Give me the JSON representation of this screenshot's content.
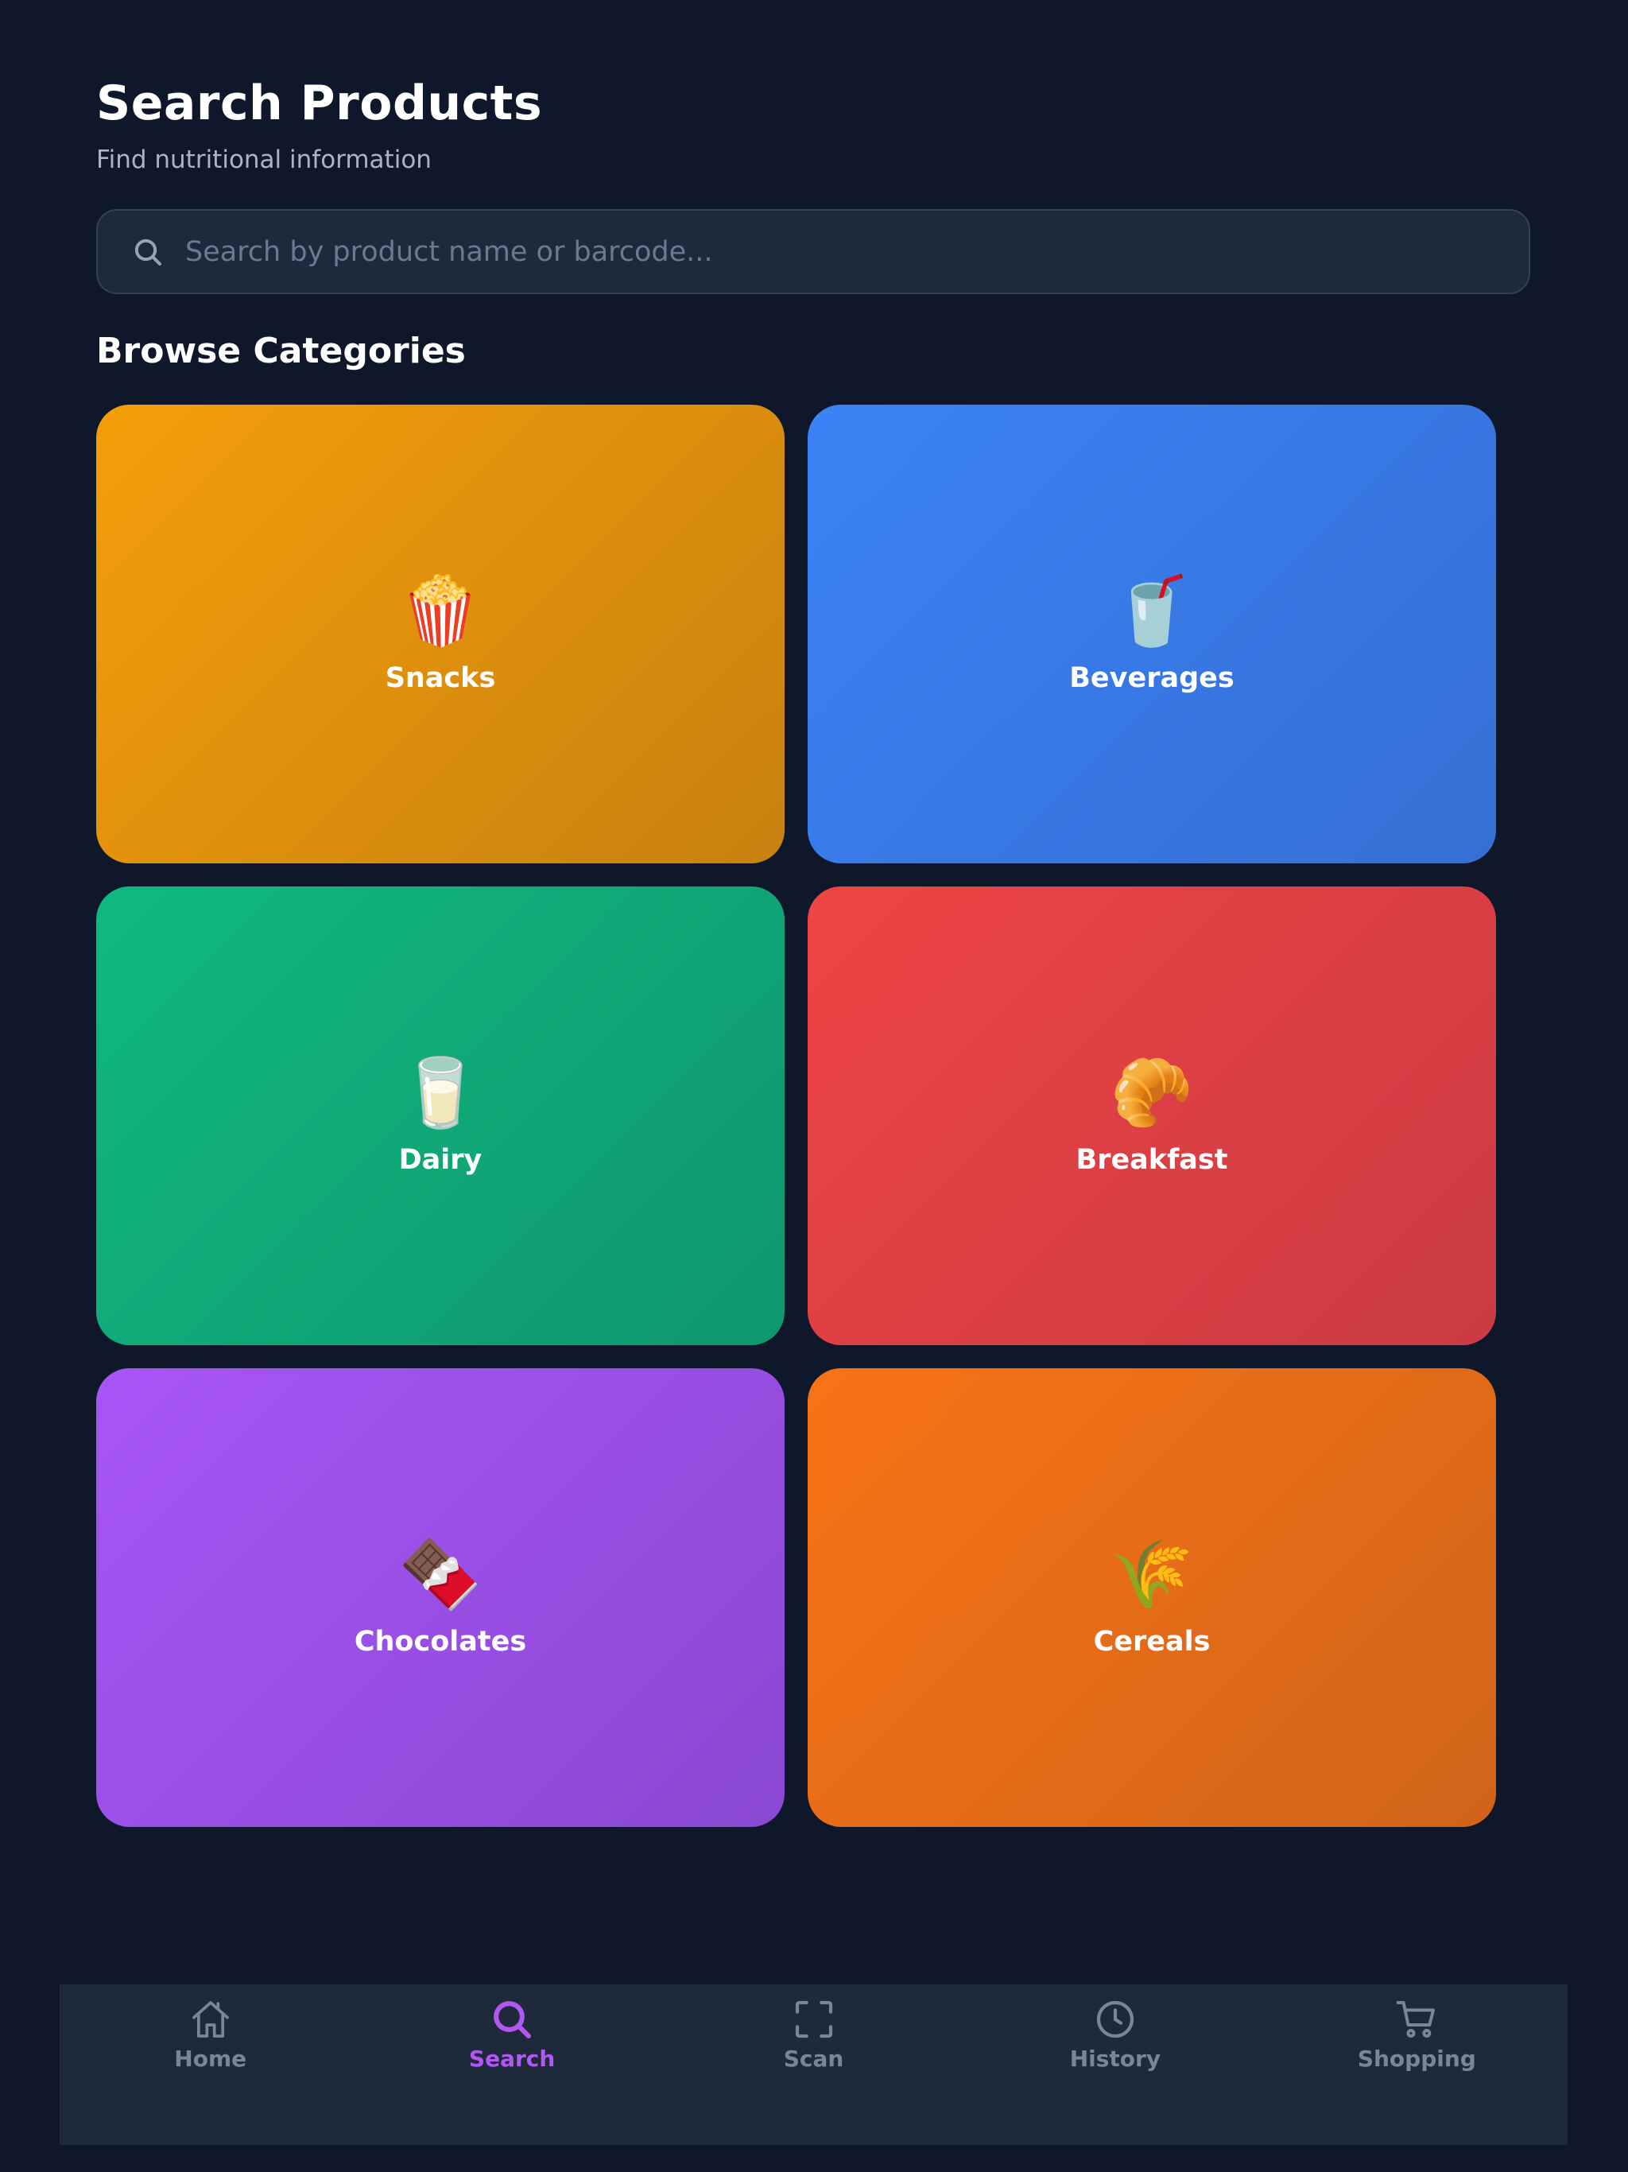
{
  "header": {
    "title": "Search Products",
    "subtitle": "Find nutritional information"
  },
  "search": {
    "placeholder": "Search by product name or barcode..."
  },
  "categories_section": {
    "title": "Browse Categories"
  },
  "categories": [
    {
      "label": "Snacks",
      "icon": "🍿",
      "icon_name": "popcorn-icon",
      "color_start": "#f59e0b",
      "color_end": "#c7810f"
    },
    {
      "label": "Beverages",
      "icon": "🥤",
      "icon_name": "cup-with-straw-icon",
      "color_start": "#3b82f6",
      "color_end": "#356fd4"
    },
    {
      "label": "Dairy",
      "icon": "🥛",
      "icon_name": "glass-of-milk-icon",
      "color_start": "#10b981",
      "color_end": "#0f966e"
    },
    {
      "label": "Breakfast",
      "icon": "🥐",
      "icon_name": "croissant-icon",
      "color_start": "#ef4444",
      "color_end": "#c93b43"
    },
    {
      "label": "Chocolates",
      "icon": "🍫",
      "icon_name": "chocolate-bar-icon",
      "color_start": "#a855f7",
      "color_end": "#8a48d2"
    },
    {
      "label": "Cereals",
      "icon": "🌾",
      "icon_name": "sheaf-of-rice-icon",
      "color_start": "#f97316",
      "color_end": "#d0641a"
    }
  ],
  "nav": {
    "active": "search",
    "active_color": "#b257f2",
    "inactive_color": "#7b8598",
    "items": [
      {
        "label": "Home",
        "icon_name": "home-icon"
      },
      {
        "label": "Search",
        "icon_name": "search-icon"
      },
      {
        "label": "Scan",
        "icon_name": "scan-icon"
      },
      {
        "label": "History",
        "icon_name": "clock-icon"
      },
      {
        "label": "Shopping",
        "icon_name": "cart-icon"
      }
    ]
  },
  "colors": {
    "background": "#0f172a",
    "surface": "#1e293b",
    "border": "#334155",
    "subtitle": "#a9b4c6",
    "placeholder": "#6b7a90"
  }
}
